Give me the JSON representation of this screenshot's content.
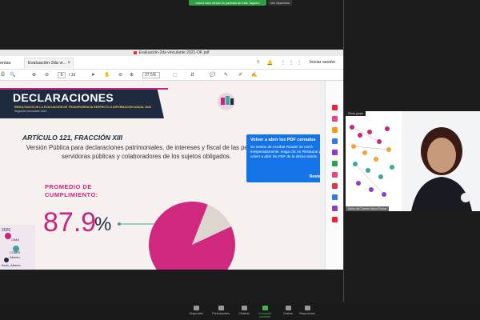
{
  "banner": {
    "share_text": "Usted está viendo la pantalla de Irais Tagarro",
    "stop_label": "Ver Opciones"
  },
  "window": {
    "title": "Evaluación-2da vinculante 2021-OK.pdf"
  },
  "menubar": {
    "tools_label": "entas",
    "doc_tab_label": "Evaluación-2da vi...",
    "doc_tab_close": "×",
    "right_icons": "? 🔔 ⋮⋮⋮",
    "signin_label": "Iniciar sesión"
  },
  "toolbar": {
    "page_current": "9",
    "page_total": "/ 16",
    "zoom": "37.5%"
  },
  "slide": {
    "header_title": "DECLARACIONES",
    "header_subtitle": "RESULTADOS DE LA EVALUACIÓN DE TRANSPARENCIA RESPECTO A INFORMACIÓN ANUAL 2020",
    "header_subtitle2": "Segunda vinculante 2021",
    "article": "ARTÍCULO 121, FRACCIÓN XIII",
    "description": "Versión Pública para declaraciones patrimoniales, de intereses y fiscal de las personas servidoras públicas y colaboradores de los sujetos obligados.",
    "promedio_line1": "PROMEDIO DE",
    "promedio_line2": "CUMPLIMIENTO:",
    "percentage": "87.9",
    "percent_sign": "%",
    "compliance_fraction": 0.879,
    "pie_color": "#d0287f",
    "pie_rest_color": "#dcd6cf",
    "left_deco_texts": [
      "2020",
      "CIMA",
      "COMIS",
      "Alberto",
      "ñado_Alberto"
    ]
  },
  "popup": {
    "title": "Volver a abrir los PDF cerrados",
    "body": "Su sesión de Acrobat Reader se cerró inesperadamente. Haga clic en Restaurar para volver a abrir los PDF de la última sesión.",
    "close": "×",
    "restore_label": "Restaurar"
  },
  "participants": {
    "thumb_tag": "Clima grupo",
    "thumb_label": "Maria del Carmen Nava Polina"
  },
  "bottombar": {
    "items": [
      {
        "label": "Seguridad",
        "icon": "shield-icon"
      },
      {
        "label": "Participantes",
        "icon": "participants-icon"
      },
      {
        "label": "Chatear",
        "icon": "chat-icon"
      },
      {
        "label": "Compartir pantalla",
        "icon": "share-screen-icon"
      },
      {
        "label": "Grabar",
        "icon": "record-icon"
      },
      {
        "label": "Reacciones",
        "icon": "reactions-icon"
      }
    ]
  }
}
